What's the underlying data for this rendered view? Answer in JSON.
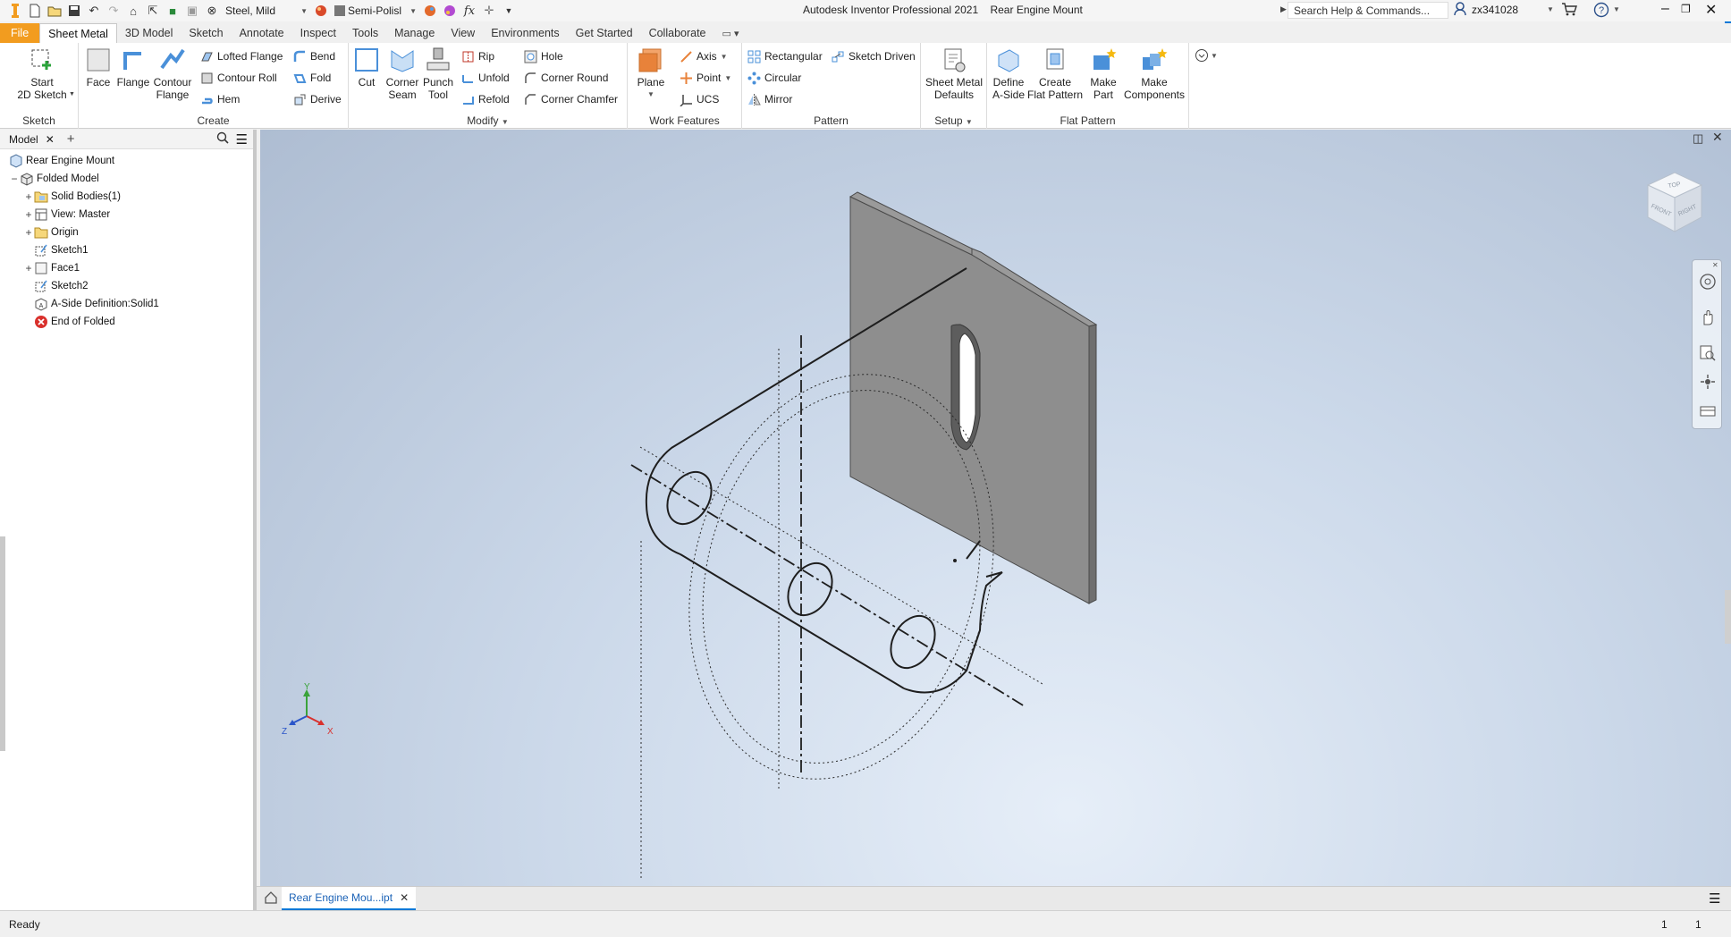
{
  "title_bar": {
    "app_title": "Autodesk Inventor Professional 2021",
    "document_title": "Rear Engine Mount",
    "material": "Steel, Mild",
    "appearance": "Semi-Polisl",
    "fx_label": "fx",
    "search_placeholder": "Search Help & Commands...",
    "user": "zx341028"
  },
  "ribbon_tabs": [
    "File",
    "Sheet Metal",
    "3D Model",
    "Sketch",
    "Annotate",
    "Inspect",
    "Tools",
    "Manage",
    "View",
    "Environments",
    "Get Started",
    "Collaborate"
  ],
  "ribbon": {
    "sketch_panel": {
      "label": "Sketch",
      "start_sketch": "Start\n2D Sketch"
    },
    "create_panel": {
      "label": "Create",
      "face": "Face",
      "flange": "Flange",
      "contour_flange": "Contour\nFlange",
      "lofted_flange": "Lofted Flange",
      "contour_roll": "Contour Roll",
      "hem": "Hem",
      "bend": "Bend",
      "fold": "Fold",
      "derive": "Derive"
    },
    "modify_panel": {
      "label": "Modify",
      "cut": "Cut",
      "corner_seam": "Corner\nSeam",
      "punch_tool": "Punch\nTool",
      "rip": "Rip",
      "unfold": "Unfold",
      "refold": "Refold",
      "hole": "Hole",
      "corner_round": "Corner Round",
      "corner_chamfer": "Corner Chamfer"
    },
    "work_features_panel": {
      "label": "Work Features",
      "plane": "Plane",
      "axis": "Axis",
      "point": "Point",
      "ucs": "UCS"
    },
    "pattern_panel": {
      "label": "Pattern",
      "rectangular": "Rectangular",
      "circular": "Circular",
      "mirror": "Mirror",
      "sketch_driven": "Sketch Driven"
    },
    "setup_panel": {
      "label": "Setup",
      "sheet_metal_defaults": "Sheet Metal\nDefaults"
    },
    "flat_pattern_panel": {
      "label": "Flat Pattern",
      "define_a_side": "Define\nA-Side",
      "create_flat_pattern": "Create\nFlat Pattern",
      "make_part": "Make\nPart",
      "make_components": "Make\nComponents"
    }
  },
  "browser": {
    "tab_label": "Model",
    "tree": [
      {
        "label": "Rear Engine Mount",
        "icon": "part-icon"
      },
      {
        "label": "Folded Model",
        "icon": "folded-model-icon"
      },
      {
        "label": "Solid Bodies(1)",
        "icon": "folder-icon"
      },
      {
        "label": "View: Master",
        "icon": "view-icon"
      },
      {
        "label": "Origin",
        "icon": "folder-icon"
      },
      {
        "label": "Sketch1",
        "icon": "sketch-icon"
      },
      {
        "label": "Face1",
        "icon": "face-icon"
      },
      {
        "label": "Sketch2",
        "icon": "sketch-icon"
      },
      {
        "label": "A-Side Definition:Solid1",
        "icon": "a-side-icon"
      },
      {
        "label": "End of Folded",
        "icon": "end-of-part-icon"
      }
    ]
  },
  "viewcube": {
    "top": "TOP",
    "front": "FRONT",
    "right": "RIGHT"
  },
  "triad": {
    "x": "X",
    "y": "Y",
    "z": "Z"
  },
  "doc_tab": {
    "label": "Rear Engine Mou...ipt"
  },
  "status": {
    "text": "Ready",
    "field_1": "1",
    "field_2": "1"
  },
  "colors": {
    "file_tab": "#f29c1f",
    "accent": "#0078d7",
    "sheet_metal_face": "#8e8e8e"
  }
}
